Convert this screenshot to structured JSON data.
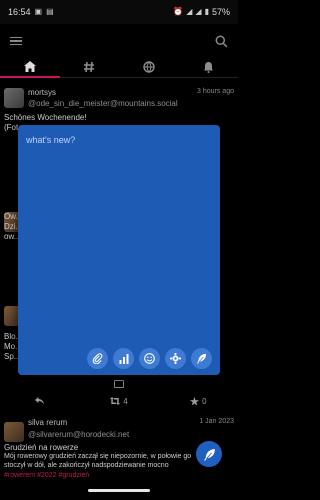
{
  "status": {
    "time": "16:54",
    "battery": "57%"
  },
  "tabs": [
    {
      "name": "home",
      "icon": "home-icon",
      "active": true
    },
    {
      "name": "hashtag",
      "icon": "hashtag-icon",
      "active": false
    },
    {
      "name": "federated",
      "icon": "globe-icon",
      "active": false
    },
    {
      "name": "notifications",
      "icon": "bell-icon",
      "active": false
    }
  ],
  "posts": [
    {
      "name": "mortsys",
      "handle": "@ode_sin_die_meister@mountains.social",
      "time": "3 hours ago",
      "lines": [
        "Schönes Wochenende!",
        "(Fot..."
      ]
    },
    {
      "lines": [
        "Ow...",
        "Dzi...",
        "ow..."
      ]
    },
    {
      "lines": [
        "Blo...",
        "Mo...",
        "Sp..."
      ]
    },
    {
      "name": "silva rerum",
      "handle": "@silvarerum@horodecki.net",
      "time": "1 Jan 2023",
      "lines": [
        "Grudzień na rowerze",
        "Mój rowerowy grudzień zaczął się niepozornie, w połowie go",
        "stoczył w dół, ale zakończył nadspodziewanie mocno"
      ],
      "hashtags": "#rowerem #2022 #grudzień"
    }
  ],
  "actions": {
    "boosts": "4",
    "favourites": "0"
  },
  "compose": {
    "placeholder": "what's new?"
  },
  "colors": {
    "accent": "#c2185b",
    "compose_bg": "#1e5bb5",
    "button_bg": "#3f7bd3"
  }
}
